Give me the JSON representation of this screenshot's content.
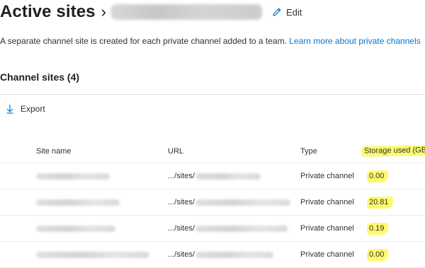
{
  "header": {
    "title": "Active sites",
    "edit_label": "Edit"
  },
  "description": {
    "text": "A separate channel site is created for each private channel added to a team.",
    "link": "Learn more about private channels"
  },
  "section_title": "Channel sites (4)",
  "toolbar": {
    "export_label": "Export"
  },
  "table": {
    "columns": [
      "Site name",
      "URL",
      "Type",
      "Storage used (GB"
    ],
    "rows": [
      {
        "url_prefix": ".../sites/",
        "type": "Private channel",
        "storage": "0.00"
      },
      {
        "url_prefix": ".../sites/",
        "type": "Private channel",
        "storage": "20.81"
      },
      {
        "url_prefix": ".../sites/",
        "type": "Private channel",
        "storage": "0.19"
      },
      {
        "url_prefix": ".../sites/",
        "type": "Private channel",
        "storage": "0.00"
      }
    ]
  },
  "colors": {
    "link": "#0078d4",
    "highlight": "#fdfa71",
    "text": "#323130"
  },
  "icons": {
    "edit": "pencil-icon",
    "export": "download-arrow-icon",
    "breadcrumb": "chevron-right-icon"
  }
}
